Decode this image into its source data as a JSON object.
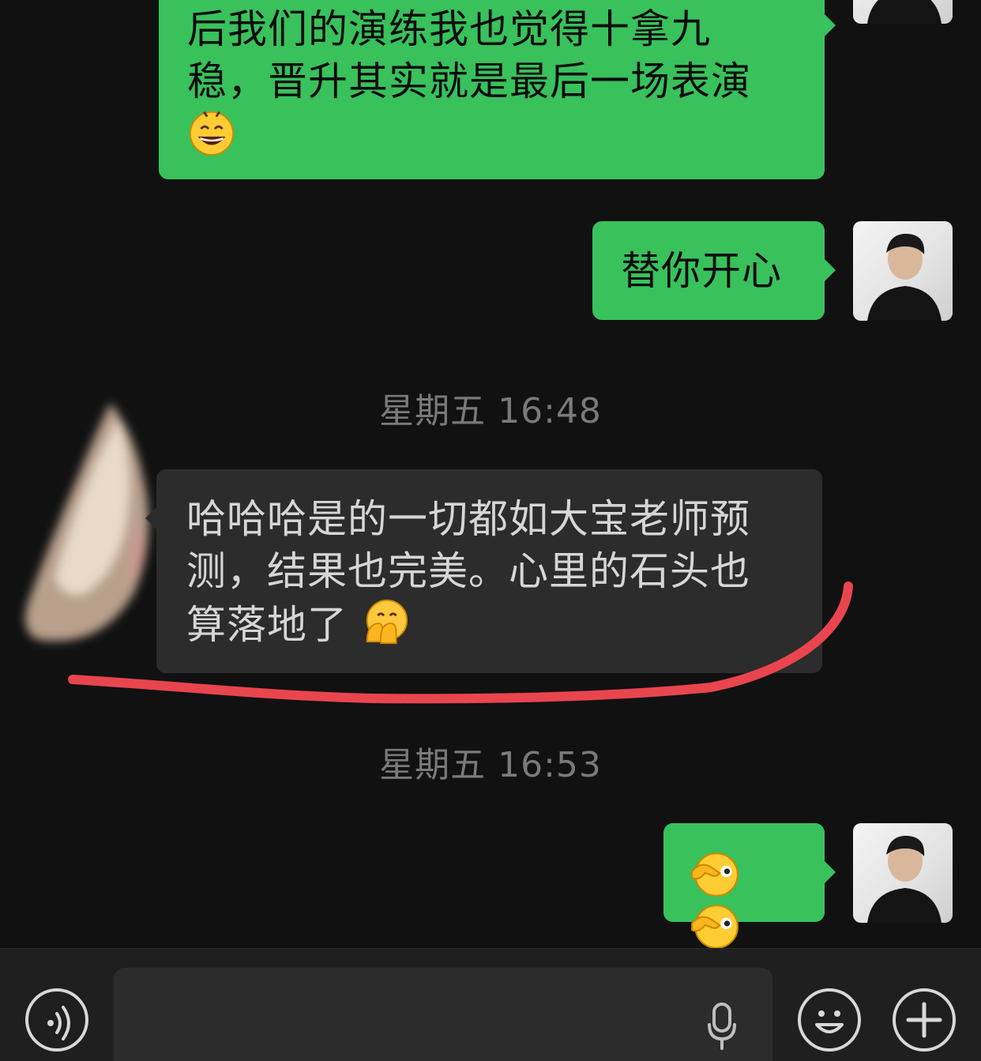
{
  "messages": [
    {
      "sender": "me",
      "text_lines": [
        "后我们的演练我也觉得十拿九",
        "稳，晋升其实就是最后一场表演"
      ],
      "emoji": "grinning-sweat-emoji"
    },
    {
      "sender": "me",
      "text": "替你开心"
    },
    {
      "sender": "them",
      "text_lines": [
        "哈哈哈是的一切都如大宝老师预",
        "测，结果也完美。心里的石头也",
        "算落地了"
      ],
      "emoji": "hand-over-mouth-emoji"
    },
    {
      "sender": "me",
      "emoji": "peeking-face-emoji"
    }
  ],
  "timestamps": [
    "星期五 16:48",
    "星期五 16:53"
  ],
  "annotation": {
    "color": "#e9454f",
    "kind": "hand-drawn-underline"
  },
  "colors": {
    "background": "#111111",
    "my_bubble": "#39c15c",
    "their_bubble": "#2c2c2c",
    "timestamp_text": "#7a7a7a",
    "input_bar": "#1f1f1f"
  },
  "input_bar": {
    "voice_icon": "voice-mode-icon",
    "mic_icon": "microphone-icon",
    "emoji_icon": "emoji-face-icon",
    "plus_icon": "plus-icon",
    "text_value": ""
  }
}
